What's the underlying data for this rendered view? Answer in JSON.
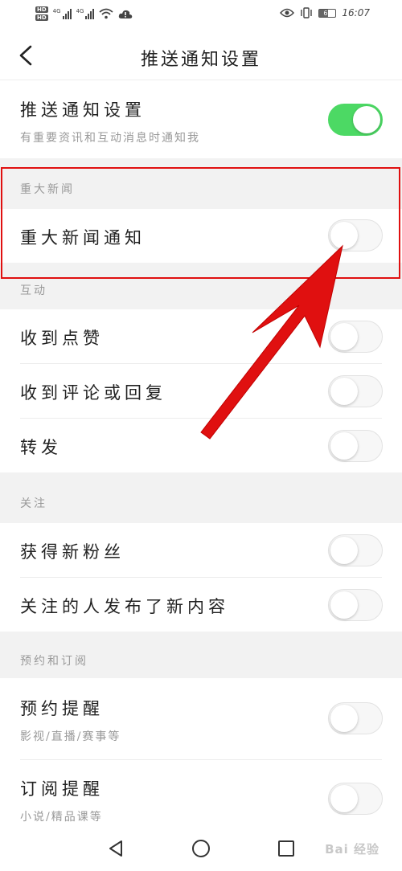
{
  "status_bar": {
    "hd_badge_1": "HD",
    "hd_badge_2": "HD",
    "network_1": "4G",
    "network_2": "4G",
    "battery_level": "65",
    "time": "16:07",
    "icons": [
      "eye-icon",
      "vibrate-icon",
      "wifi-icon",
      "cloud-icon",
      "battery-icon"
    ]
  },
  "nav": {
    "back_icon": "chevron-left-icon",
    "title": "推送通知设置"
  },
  "master": {
    "label": "推送通知设置",
    "subtitle": "有重要资讯和互动消息时通知我",
    "enabled": true
  },
  "sections": {
    "major_news": {
      "title": "重大新闻",
      "items": [
        {
          "label": "重大新闻通知",
          "enabled": false
        }
      ]
    },
    "interaction": {
      "title": "互动",
      "items": [
        {
          "label": "收到点赞",
          "enabled": false
        },
        {
          "label": "收到评论或回复",
          "enabled": false
        },
        {
          "label": "转发",
          "enabled": false
        }
      ]
    },
    "follow": {
      "title": "关注",
      "items": [
        {
          "label": "获得新粉丝",
          "enabled": false
        },
        {
          "label": "关注的人发布了新内容",
          "enabled": false
        }
      ]
    },
    "subscribe": {
      "title": "预约和订阅",
      "items": [
        {
          "label": "预约提醒",
          "subtitle": "影视/直播/赛事等",
          "enabled": false
        },
        {
          "label": "订阅提醒",
          "subtitle": "小说/精品课等",
          "enabled": false
        }
      ]
    }
  },
  "annotation": {
    "color": "#e01010"
  },
  "colors": {
    "toggle_on": "#4cd964",
    "section_bg": "#f2f2f2"
  },
  "system_nav": {
    "icons": [
      "back-triangle-icon",
      "home-circle-icon",
      "recents-square-icon"
    ]
  },
  "watermark": "Bai 经验"
}
